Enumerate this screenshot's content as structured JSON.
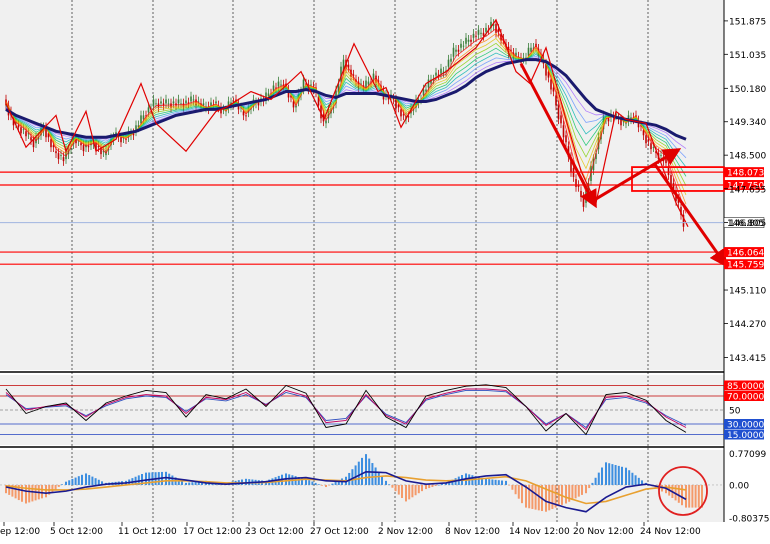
{
  "colors": {
    "background": "#f0f0f0",
    "grid": "#000000",
    "bull_candle": "#3a7d3a",
    "bear_candle": "#c00000",
    "zigzag": "#e00000",
    "ma_slow": "#1a1a6e",
    "level_line": "#ff0000",
    "bid_line": "#a0b4e0",
    "hist_pos": "#3c8ee0",
    "hist_neg": "#f49a6a",
    "macd_line": "#1a1a90",
    "signal_line": "#e8a030",
    "stoch_main": "#000000",
    "stoch_signal": "#c00060",
    "stoch_third": "#3050c0",
    "circle": "#e02020"
  },
  "chart_data": [
    {
      "type": "line",
      "panel": "price",
      "y_ticks": [
        "151.875",
        "151.035",
        "150.180",
        "149.340",
        "148.500",
        "147.655",
        "146.805",
        "145.110",
        "144.270",
        "143.415"
      ],
      "ylim": [
        143.1,
        152.4
      ],
      "levels": [
        {
          "value": 148.073,
          "label": "148.073",
          "boxed": true
        },
        {
          "value": 147.75,
          "label": "147.750",
          "boxed": true
        },
        {
          "value": 146.064,
          "label": "146.064",
          "boxed": true
        },
        {
          "value": 145.759,
          "label": "145.759",
          "boxed": true
        }
      ],
      "current_price": {
        "value": 146.805,
        "label": "146.805"
      },
      "x": [
        0,
        10,
        20,
        30,
        40,
        50,
        60,
        70,
        80,
        90,
        100,
        110,
        120,
        130,
        140,
        150,
        160,
        170,
        180,
        190,
        200,
        210,
        220,
        230,
        240,
        250,
        260,
        270,
        280,
        290,
        300,
        310,
        320,
        330,
        340,
        350,
        360,
        370,
        380,
        390,
        400,
        410,
        420,
        430,
        440,
        450,
        460,
        470,
        480,
        490,
        500,
        510,
        520,
        530,
        540,
        550,
        560,
        570,
        580,
        590,
        600,
        610,
        620,
        630,
        640,
        650,
        660,
        670,
        680
      ],
      "close": [
        149.9,
        149.3,
        149.1,
        148.8,
        149.2,
        148.6,
        148.4,
        148.9,
        148.7,
        148.8,
        148.5,
        149.0,
        148.9,
        149.1,
        149.5,
        149.8,
        149.8,
        149.8,
        149.8,
        149.9,
        149.7,
        149.8,
        149.6,
        149.9,
        149.5,
        149.8,
        149.9,
        150.2,
        150.3,
        149.7,
        150.3,
        150.2,
        149.3,
        149.8,
        150.9,
        150.4,
        150.2,
        150.5,
        150.0,
        149.9,
        149.4,
        149.7,
        150.1,
        150.5,
        150.6,
        151.1,
        151.3,
        151.5,
        151.6,
        151.8,
        151.3,
        151.0,
        150.9,
        151.3,
        150.8,
        150.0,
        149.0,
        147.9,
        147.3,
        148.4,
        149.4,
        149.5,
        149.3,
        149.5,
        149.0,
        148.6,
        148.4,
        147.6,
        146.8
      ],
      "ma_slow": [
        149.65,
        149.5,
        149.4,
        149.3,
        149.2,
        149.1,
        149.05,
        149.0,
        148.95,
        148.95,
        148.95,
        149.0,
        149.05,
        149.1,
        149.2,
        149.3,
        149.4,
        149.5,
        149.55,
        149.6,
        149.65,
        149.65,
        149.7,
        149.75,
        149.8,
        149.85,
        149.9,
        150.0,
        150.1,
        150.1,
        150.15,
        150.1,
        150.0,
        149.95,
        150.05,
        150.05,
        150.05,
        150.05,
        150.0,
        149.95,
        149.9,
        149.85,
        149.85,
        149.9,
        150.0,
        150.1,
        150.25,
        150.45,
        150.6,
        150.7,
        150.8,
        150.85,
        150.9,
        150.9,
        150.85,
        150.7,
        150.5,
        150.2,
        149.9,
        149.65,
        149.55,
        149.45,
        149.4,
        149.35,
        149.3,
        149.25,
        149.15,
        149.0,
        148.9
      ],
      "zigzag": [
        [
          0,
          149.8
        ],
        [
          20,
          148.7
        ],
        [
          50,
          149.5
        ],
        [
          60,
          148.6
        ],
        [
          80,
          149.6
        ],
        [
          90,
          148.6
        ],
        [
          110,
          148.9
        ],
        [
          135,
          150.3
        ],
        [
          150,
          149.3
        ],
        [
          180,
          148.6
        ],
        [
          210,
          149.6
        ],
        [
          220,
          149.7
        ],
        [
          245,
          150.1
        ],
        [
          265,
          149.9
        ],
        [
          295,
          150.6
        ],
        [
          318,
          149.4
        ],
        [
          348,
          151.3
        ],
        [
          372,
          150.1
        ],
        [
          380,
          150.2
        ],
        [
          395,
          149.2
        ],
        [
          420,
          150.3
        ],
        [
          440,
          150.6
        ],
        [
          470,
          151.2
        ],
        [
          490,
          151.9
        ],
        [
          510,
          150.6
        ],
        [
          524,
          150.3
        ],
        [
          540,
          151.2
        ],
        [
          560,
          149.4
        ],
        [
          575,
          148.1
        ],
        [
          590,
          147.3
        ],
        [
          610,
          149.6
        ],
        [
          620,
          149.4
        ],
        [
          640,
          149.3
        ],
        [
          652,
          148.5
        ],
        [
          670,
          147.3
        ],
        [
          682,
          146.7
        ]
      ],
      "arrows": [
        [
          [
            515,
            150.8
          ],
          [
            588,
            147.3
          ]
        ],
        [
          [
            590,
            147.4
          ],
          [
            670,
            148.6
          ]
        ],
        [
          [
            648,
            148.3
          ],
          [
            718,
            145.8
          ]
        ]
      ]
    },
    {
      "type": "line",
      "panel": "oscillator",
      "y_ticks": [
        "85.0000",
        "70.0000",
        "50",
        "30.0000",
        "15.0000"
      ],
      "ylim": [
        0,
        100
      ],
      "levels": [
        85,
        70,
        50,
        30,
        15
      ],
      "x": [
        0,
        20,
        40,
        60,
        80,
        100,
        120,
        140,
        160,
        180,
        200,
        220,
        240,
        260,
        280,
        300,
        320,
        340,
        360,
        380,
        400,
        420,
        440,
        460,
        480,
        500,
        520,
        540,
        560,
        580,
        600,
        620,
        640,
        660,
        680
      ],
      "main": [
        80,
        45,
        55,
        60,
        35,
        60,
        70,
        78,
        75,
        40,
        72,
        66,
        80,
        55,
        85,
        74,
        25,
        30,
        78,
        40,
        25,
        70,
        78,
        84,
        86,
        82,
        55,
        20,
        45,
        15,
        72,
        75,
        64,
        35,
        18
      ],
      "signal": [
        75,
        50,
        55,
        58,
        40,
        58,
        68,
        72,
        70,
        45,
        68,
        65,
        75,
        57,
        78,
        70,
        32,
        35,
        72,
        42,
        30,
        66,
        74,
        80,
        80,
        78,
        55,
        28,
        45,
        22,
        68,
        70,
        62,
        40,
        25
      ],
      "third": [
        72,
        52,
        54,
        56,
        42,
        56,
        66,
        70,
        68,
        48,
        66,
        63,
        72,
        58,
        75,
        68,
        35,
        38,
        70,
        44,
        32,
        64,
        72,
        78,
        78,
        76,
        55,
        30,
        45,
        25,
        65,
        68,
        60,
        42,
        28
      ]
    },
    {
      "type": "bar",
      "panel": "macd",
      "y_ticks": [
        "0.77099",
        "0.00",
        "-0.80375"
      ],
      "ylim": [
        -0.9,
        0.85
      ],
      "x": [
        0,
        20,
        40,
        60,
        80,
        100,
        120,
        140,
        160,
        180,
        200,
        220,
        240,
        260,
        280,
        300,
        320,
        340,
        360,
        380,
        400,
        420,
        440,
        460,
        480,
        500,
        520,
        540,
        560,
        580,
        600,
        620,
        640,
        660,
        680
      ],
      "histogram": [
        -0.2,
        -0.45,
        -0.3,
        0.08,
        0.28,
        0.05,
        0.1,
        0.3,
        0.32,
        0.05,
        0.1,
        0.05,
        0.15,
        0.1,
        0.28,
        0.15,
        -0.05,
        0.2,
        0.75,
        0.1,
        -0.4,
        -0.1,
        0.05,
        0.28,
        0.15,
        0.1,
        -0.55,
        -0.65,
        -0.45,
        -0.2,
        0.55,
        0.42,
        0.05,
        -0.2,
        -0.55
      ],
      "macd": [
        -0.05,
        -0.15,
        -0.2,
        -0.15,
        -0.05,
        0.02,
        0.05,
        0.12,
        0.18,
        0.12,
        0.05,
        0.02,
        0.05,
        0.08,
        0.15,
        0.18,
        0.1,
        0.08,
        0.32,
        0.3,
        0.1,
        0.02,
        0.05,
        0.15,
        0.22,
        0.25,
        -0.05,
        -0.4,
        -0.55,
        -0.65,
        -0.3,
        -0.05,
        0.02,
        -0.08,
        -0.35
      ],
      "signal": [
        -0.02,
        -0.08,
        -0.12,
        -0.12,
        -0.1,
        -0.05,
        0.0,
        0.05,
        0.1,
        0.1,
        0.08,
        0.05,
        0.05,
        0.06,
        0.1,
        0.14,
        0.12,
        0.1,
        0.18,
        0.22,
        0.18,
        0.12,
        0.1,
        0.12,
        0.16,
        0.2,
        0.1,
        -0.1,
        -0.3,
        -0.45,
        -0.4,
        -0.25,
        -0.1,
        -0.05,
        -0.12
      ]
    }
  ],
  "x_labels": [
    "ep 12:00",
    "5 Oct 12:00",
    "11 Oct 12:00",
    "17 Oct 12:00",
    "23 Oct 12:00",
    "27 Oct 12:00",
    "2 Nov 12:00",
    "8 Nov 12:00",
    "14 Nov 12:00",
    "20 Nov 12:00",
    "24 Nov 12:00"
  ]
}
